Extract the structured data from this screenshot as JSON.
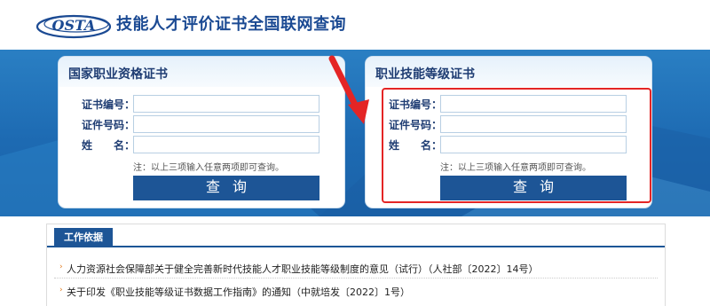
{
  "header": {
    "logo_text": "OSTA",
    "title": "技能人才评价证书全国联网查询"
  },
  "panels": [
    {
      "title": "国家职业资格证书",
      "fields": [
        {
          "label": "证书编号：",
          "value": "",
          "placeholder": ""
        },
        {
          "label": "证件号码：",
          "value": "",
          "placeholder": ""
        },
        {
          "label": "姓　　名：",
          "value": "",
          "placeholder": ""
        }
      ],
      "note": "注：以上三项输入任意两项即可查询。",
      "button_label": "查询"
    },
    {
      "title": "职业技能等级证书",
      "fields": [
        {
          "label": "证书编号：",
          "value": "",
          "placeholder": ""
        },
        {
          "label": "证件号码：",
          "value": "",
          "placeholder": ""
        },
        {
          "label": "姓　　名：",
          "value": "",
          "placeholder": ""
        }
      ],
      "note": "注：以上三项输入任意两项即可查询。",
      "button_label": "查询"
    }
  ],
  "content": {
    "tab_label": "工作依据",
    "items": [
      "人力资源社会保障部关于健全完善新时代技能人才职业技能等级制度的意见（试行）（人社部〔2022〕14号）",
      "关于印发《职业技能等级证书数据工作指南》的通知（中就培发〔2022〕1号）"
    ]
  },
  "colors": {
    "brand_blue": "#1d5596",
    "title_blue": "#1b4a93",
    "band_blue": "#1d6ab2",
    "highlight_red": "#e42525",
    "bullet_orange": "#e27a1d"
  }
}
